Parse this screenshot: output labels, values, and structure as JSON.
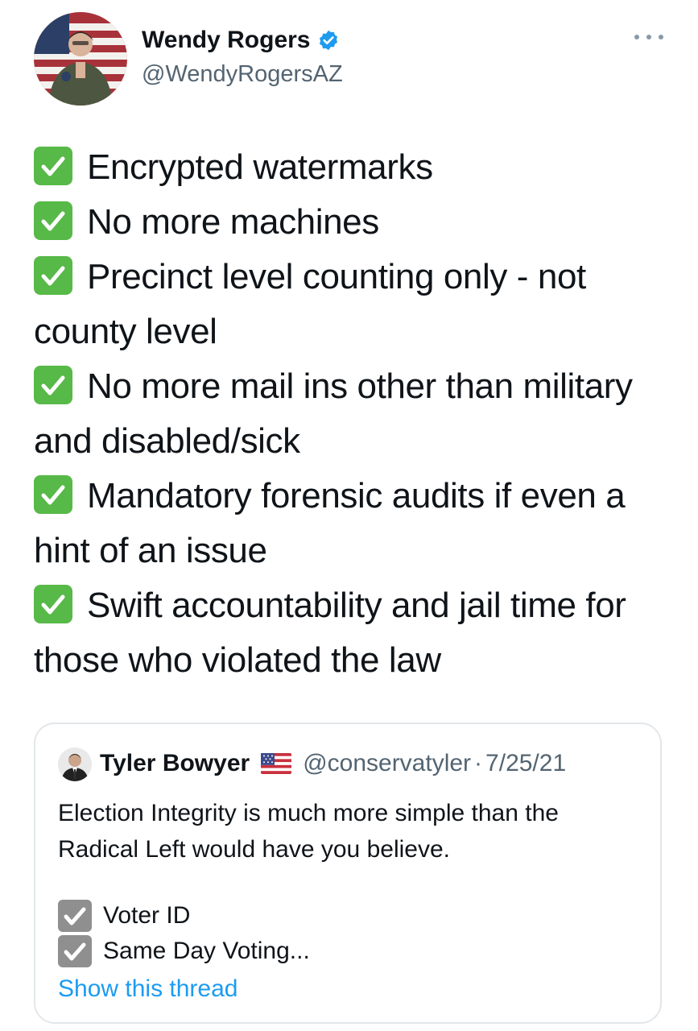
{
  "author": {
    "display_name": "Wendy Rogers",
    "handle": "@WendyRogersAZ",
    "verified_icon": "verified-badge-icon",
    "verified_color": "#1d9bf0"
  },
  "menu": {
    "icon": "more-options-icon"
  },
  "tweet": {
    "lines": [
      {
        "check": true,
        "text": "Encrypted watermarks"
      },
      {
        "check": true,
        "text": "No more machines"
      },
      {
        "check": true,
        "text": "Precinct level counting only - not"
      },
      {
        "check": false,
        "text": "county level"
      },
      {
        "check": true,
        "text": "No more mail ins other than military"
      },
      {
        "check": false,
        "text": "and disabled/sick"
      },
      {
        "check": true,
        "text": "Mandatory forensic audits if even a"
      },
      {
        "check": false,
        "text": "hint of an issue"
      },
      {
        "check": true,
        "text": "Swift accountability and jail time for"
      },
      {
        "check": false,
        "text": "those who violated the law"
      }
    ],
    "check_color": "#57b947"
  },
  "quote": {
    "name": "Tyler Bowyer",
    "flag_icon": "us-flag-icon",
    "handle": "@conservatyler",
    "separator": "·",
    "date": "7/25/21",
    "text": "Election Integrity is much more simple than the Radical Left would have you believe.",
    "items": [
      "Voter ID",
      "Same Day Voting..."
    ],
    "show_thread": "Show this thread",
    "link_color": "#1d9bf0"
  }
}
